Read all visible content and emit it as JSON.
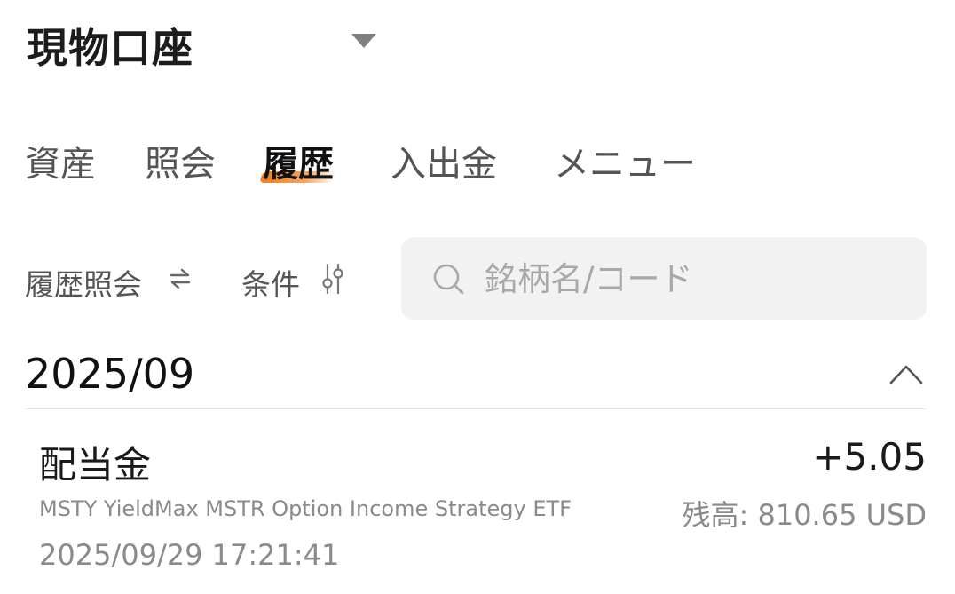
{
  "header": {
    "account_title": "現物口座"
  },
  "tabs": [
    {
      "label": "資産"
    },
    {
      "label": "照会"
    },
    {
      "label": "履歴"
    },
    {
      "label": "入出金"
    },
    {
      "label": "メニュー"
    }
  ],
  "active_tab": "履歴",
  "filters": {
    "history_label": "履歴照会",
    "condition_label": "条件"
  },
  "search": {
    "placeholder": "銘柄名/コード"
  },
  "section": {
    "month": "2025/09"
  },
  "transactions": [
    {
      "type": "配当金",
      "amount": "+5.05",
      "name": "MSTY YieldMax MSTR Option Income Strategy ETF",
      "balance": "残高: 810.65 USD",
      "datetime": "2025/09/29 17:21:41"
    }
  ],
  "colors": {
    "accent": "#f07d1d",
    "text": "#1a1a1a",
    "muted": "#8a8a8a",
    "search_bg": "#f2f2f2"
  },
  "icons": [
    "caret-down-icon",
    "swap-icon",
    "sliders-icon",
    "search-icon",
    "chevron-up-icon"
  ]
}
